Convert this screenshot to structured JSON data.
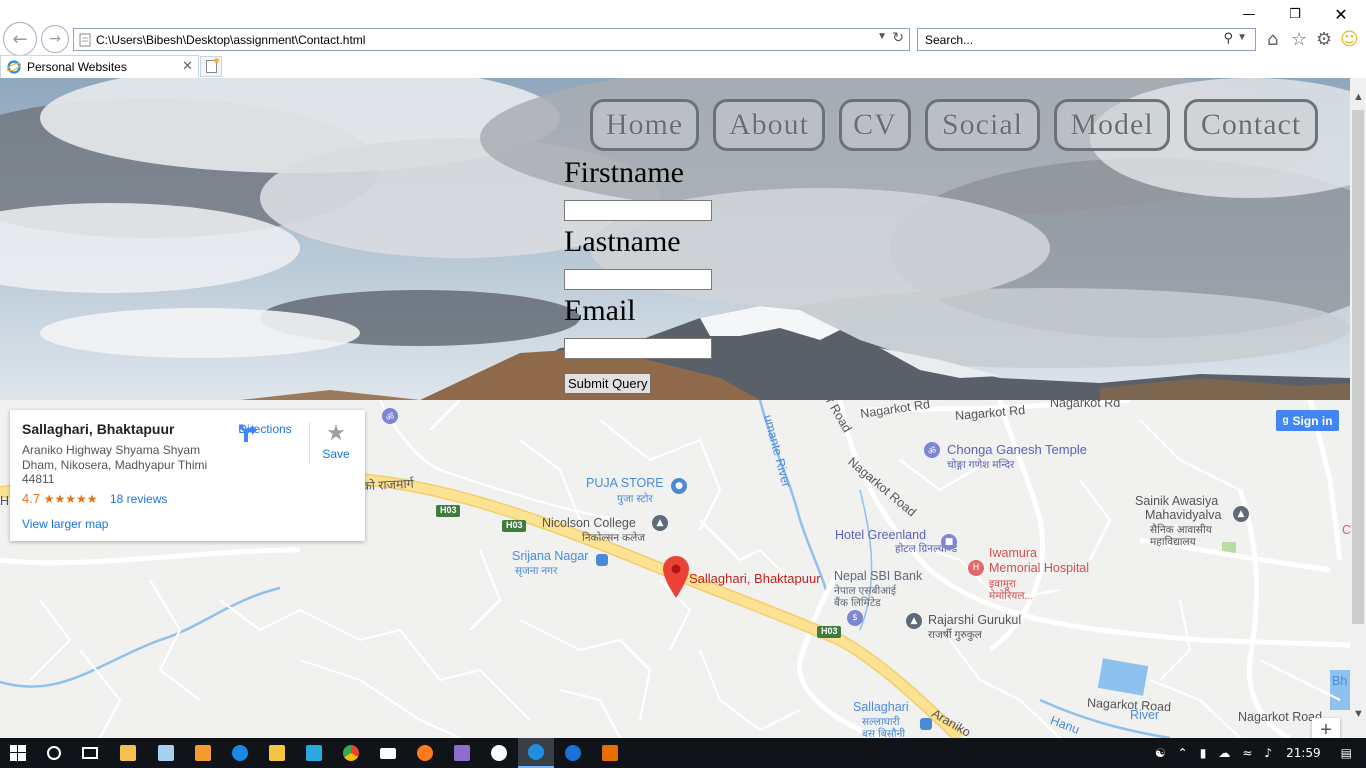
{
  "window": {
    "minimize_icon": "minimize-icon",
    "restore_icon": "restore-icon",
    "close_icon": "close-icon"
  },
  "browser": {
    "address": "C:\\Users\\Bibesh\\Desktop\\assignment\\Contact.html",
    "search_placeholder": "Search...",
    "tab_title": "Personal Websites"
  },
  "nav": {
    "items": [
      "Home",
      "About",
      "CV",
      "Social",
      "Model",
      "Contact"
    ]
  },
  "form": {
    "firstname_label": "Firstname",
    "lastname_label": "Lastname",
    "email_label": "Email",
    "submit_label": "Submit Query"
  },
  "map": {
    "card": {
      "name": "Sallaghari, Bhaktapuur",
      "address": "Araniko Highway Shyama Shyam Dham, Nikosera, Madhyapur Thimi 44811",
      "rating": "4.7",
      "stars": "★★★★★",
      "reviews": "18 reviews",
      "view_larger": "View larger map",
      "directions": "Directions",
      "save": "Save"
    },
    "signin": "Sign in",
    "pin_label": "Sallaghari, Bhaktapuur",
    "labels": {
      "chonga": "Chonga Ganesh Temple",
      "chonga_np": "चोङ्गा गणेश मन्दिर",
      "puja": "PUJA STORE",
      "puja_np": "पुजा स्टोर",
      "nicolson": "Nicolson College",
      "nicolson_np": "निकोल्सन कलेज",
      "srijana": "Srijana Nagar",
      "srijana_np": "सृजना नगर",
      "greenland": "Hotel Greenland",
      "greenland_np": "होटल ग्रिनल्याण्ड",
      "iwamura1": "Iwamura",
      "iwamura2": "Memorial Hospital",
      "iwamura_np1": "इवामुरा",
      "iwamura_np2": "मेमोरियल...",
      "sbi": "Nepal SBI Bank",
      "sbi_np1": "नेपाल एसबीआई",
      "sbi_np2": "बैंक लिमिटेड",
      "rajarshi": "Rajarshi Gurukul",
      "rajarshi_np": "राजर्षी गुरुकुल",
      "sainik1": "Sainik Awasiya",
      "sainik2": "Mahavidyalva",
      "sainik_np1": "सैनिक आवासीय",
      "sainik_np2": "महाविद्यालय",
      "sallaghari": "Sallaghari",
      "sallaghari_np1": "सल्लाघारी",
      "sallaghari_np2": "बस बिसौनी",
      "nagarkot_rd1": "Nagarkot Rd",
      "nagarkot_rd2": "Nagarkot Rd",
      "nagarkot_road1": "Nagarkot Road",
      "nagarkot_road2": "Nagarkot Road",
      "nagarkot_road3": "Nagarkot Road",
      "r_road": "r Road",
      "river": "umante River",
      "h03a": "H03",
      "h03b": "H03",
      "h03c": "H03",
      "rajmarg": "को राजमार्ग",
      "araniko": "Araniko",
      "bh": "Bh",
      "h_edge": "H",
      "b_edge": "B",
      "c_edge": "C",
      "hanu": "Hanu",
      "river2": "River"
    },
    "zoom_in": "+"
  },
  "taskbar": {
    "time": "21:59"
  },
  "colors": {
    "accent": "#1a73e8",
    "pin": "#ea4335",
    "highway": "#fde293",
    "poi_blue": "#4a8bd8",
    "poi_purple": "#7b86d6",
    "poi_red": "#e06a6a"
  }
}
